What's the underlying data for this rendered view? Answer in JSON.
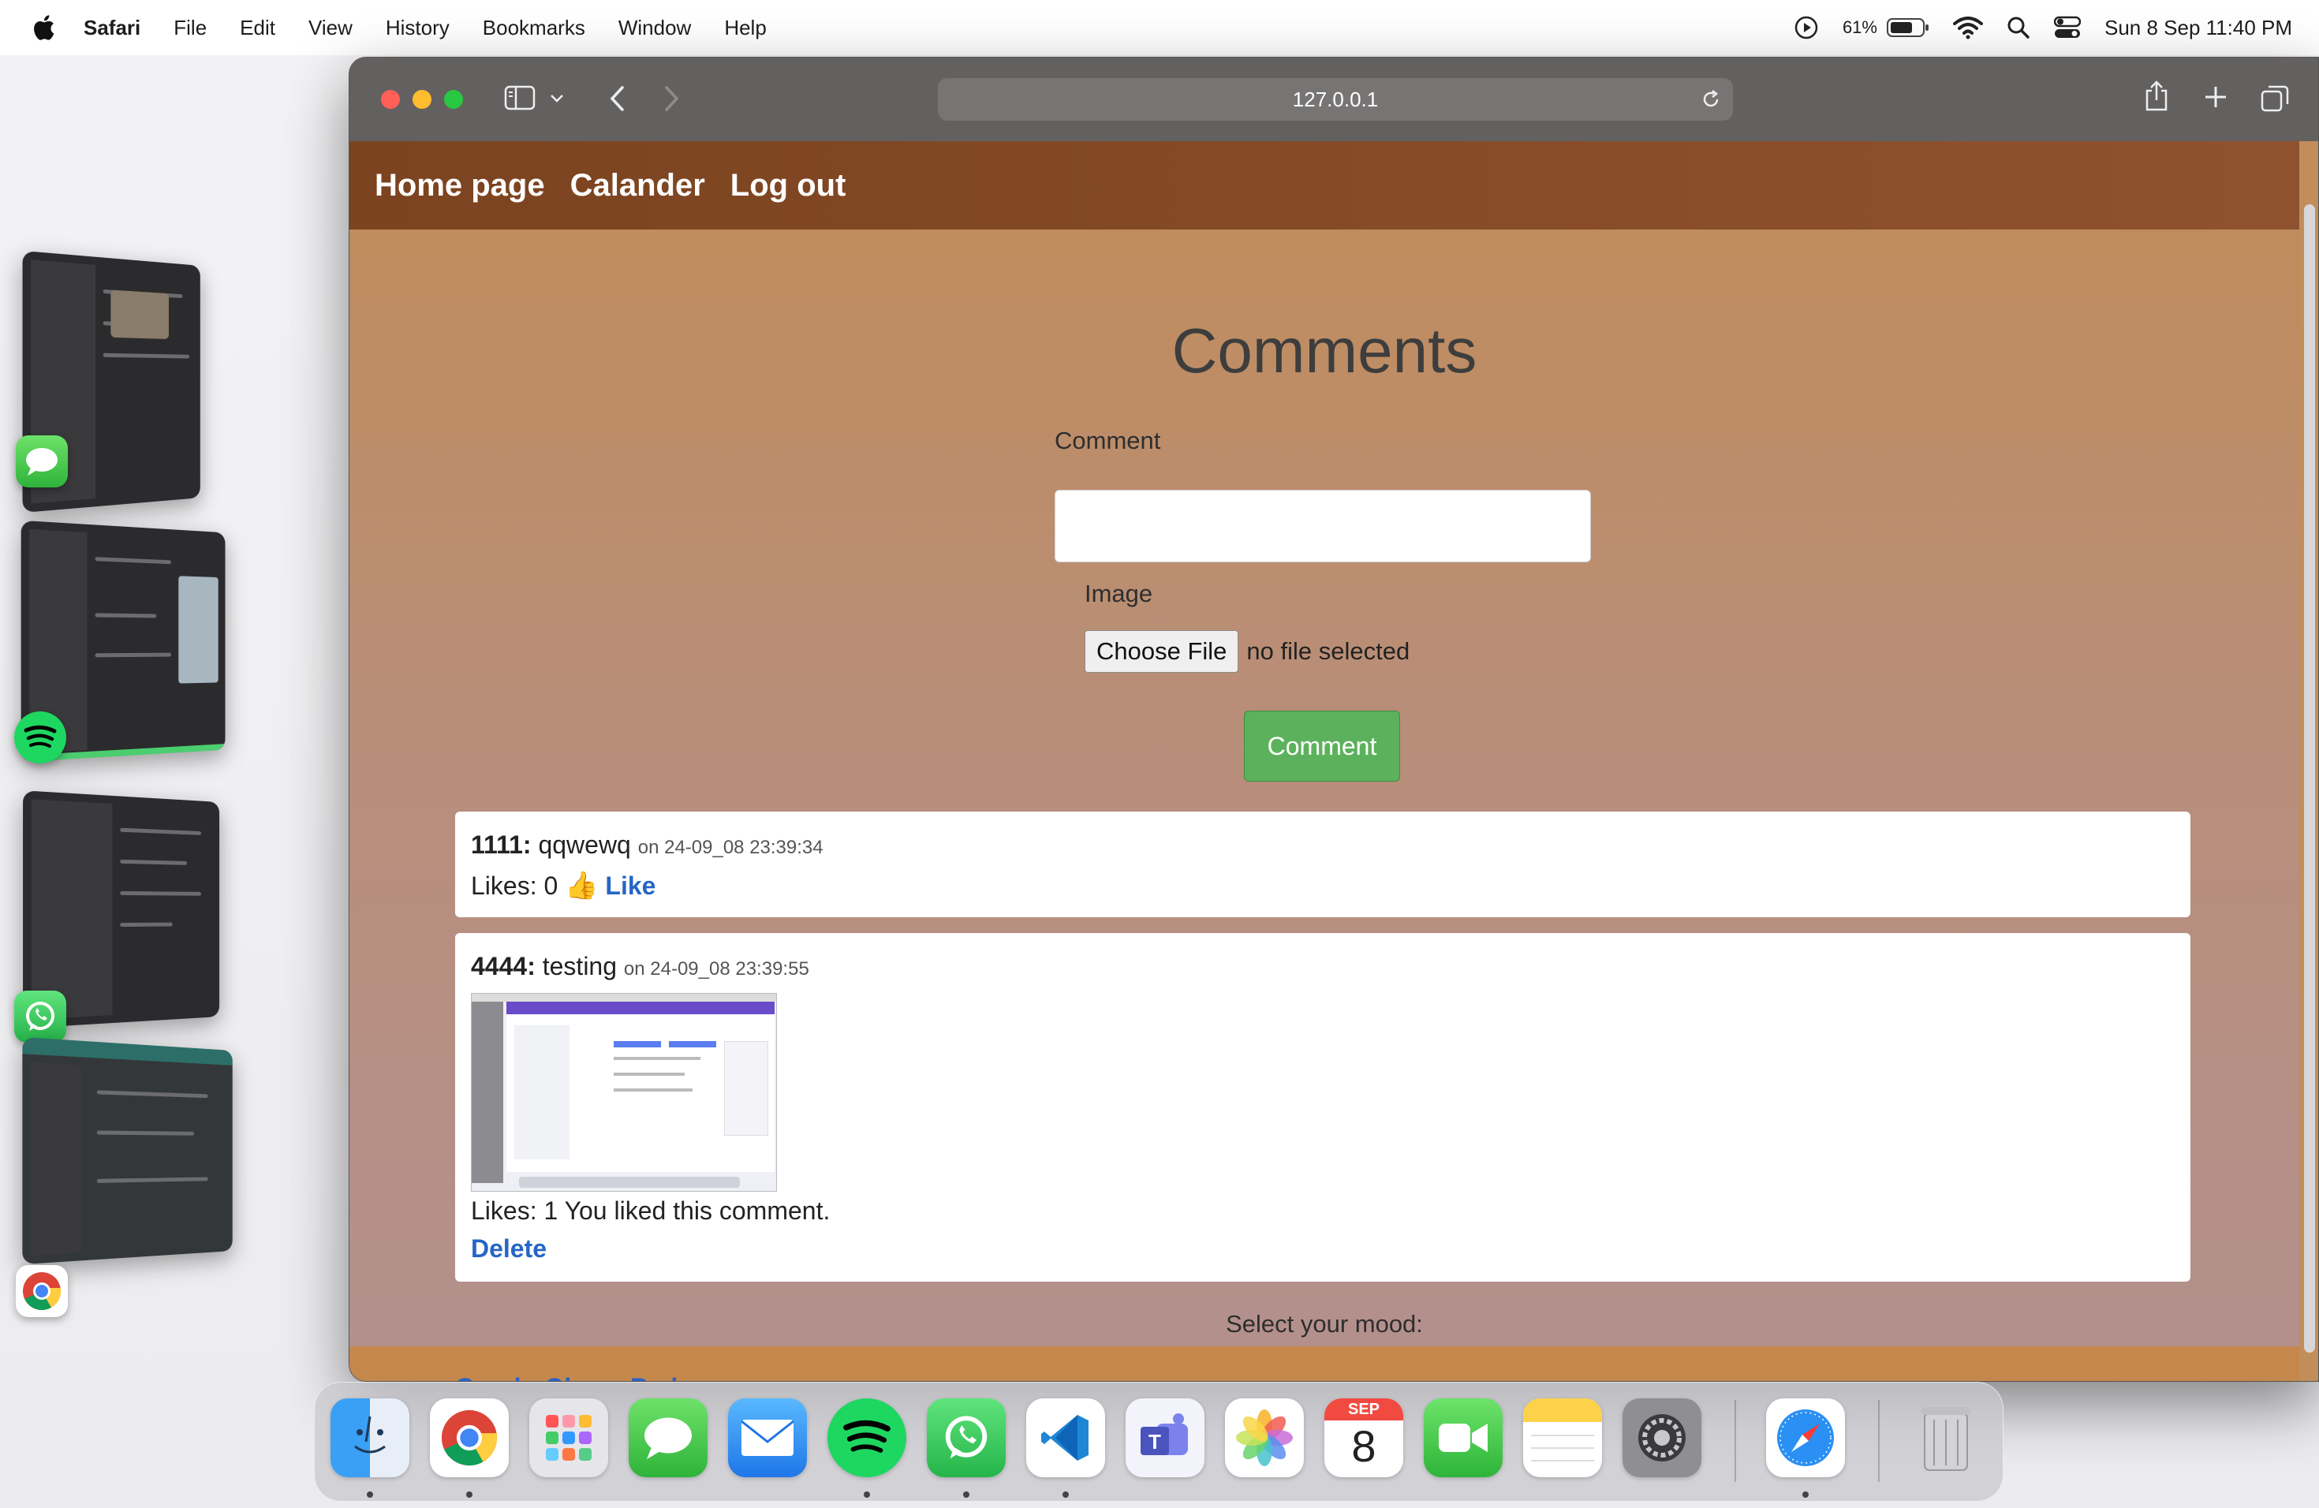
{
  "menubar": {
    "app_name": "Safari",
    "menus": [
      "File",
      "Edit",
      "View",
      "History",
      "Bookmarks",
      "Window",
      "Help"
    ],
    "battery_percent": "61%",
    "datetime": "Sun 8 Sep  11:40 PM"
  },
  "stage_manager": {
    "apps": [
      "messages",
      "spotify",
      "whatsapp",
      "chrome"
    ]
  },
  "browser": {
    "address": "127.0.0.1"
  },
  "site": {
    "nav": [
      "Home page",
      "Calander",
      "Log out"
    ],
    "title": "Comments",
    "form": {
      "comment_label": "Comment",
      "comment_value": "",
      "image_label": "Image",
      "choose_file_label": "Choose File",
      "no_file_text": "no file selected",
      "submit_label": "Comment"
    },
    "comments": [
      {
        "author": "1111:",
        "text": "qqwewq",
        "timestamp": "on 24-09_08 23:39:34",
        "likes_text": "Likes: 0",
        "like_emoji": "👍",
        "like_label": "Like"
      },
      {
        "author": "4444:",
        "text": "testing",
        "timestamp": "on 24-09_08 23:39:55",
        "likes_text": "Likes: 1 You liked this comment.",
        "delete_label": "Delete"
      }
    ],
    "mood": {
      "label": "Select your mood:",
      "options": [
        "Good",
        "Okay",
        "Bad"
      ]
    }
  },
  "dock": {
    "apps": [
      "finder",
      "chrome",
      "launchpad",
      "messages",
      "mail",
      "spotify",
      "whatsapp",
      "vscode",
      "teams",
      "photos",
      "calendar",
      "facetime",
      "notes",
      "system-settings",
      "safari",
      "trash"
    ],
    "calendar_month": "SEP",
    "calendar_day": "8"
  },
  "colors": {
    "navbar": "#7b431f",
    "page_bg_top": "#c18c58",
    "page_bg_bottom": "#b3908e",
    "submit_green": "#5cb25c",
    "link_blue": "#2565c7"
  }
}
